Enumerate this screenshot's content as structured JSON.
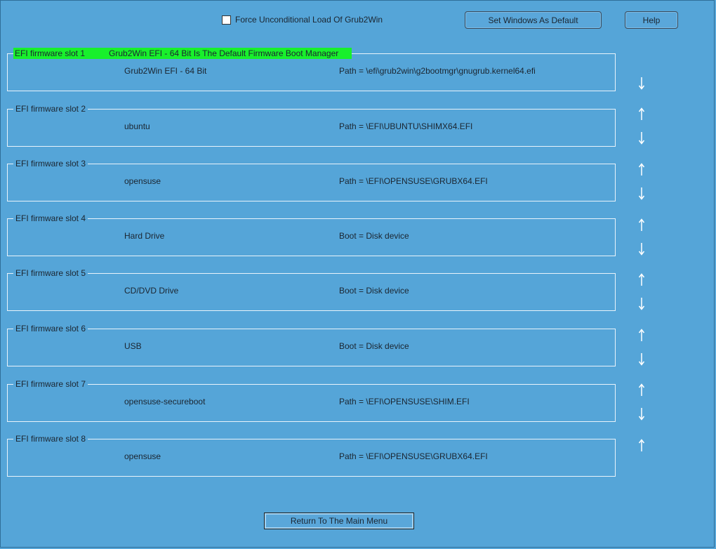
{
  "top": {
    "force_label": "Force Unconditional Load Of Grub2Win",
    "force_checked": false,
    "set_default_label": "Set Windows As Default",
    "help_label": "Help"
  },
  "slots": [
    {
      "legend": "EFI firmware slot 1",
      "note": "Grub2Win EFI - 64 Bit Is The Default Firmware Boot Manager",
      "name": "Grub2Win EFI - 64 Bit",
      "path": "Path = \\efi\\grub2win\\g2bootmgr\\gnugrub.kernel64.efi"
    },
    {
      "legend": "EFI firmware slot 2",
      "name": "ubuntu",
      "path": "Path = \\EFI\\UBUNTU\\SHIMX64.EFI"
    },
    {
      "legend": "EFI firmware slot 3",
      "name": "opensuse",
      "path": "Path = \\EFI\\OPENSUSE\\GRUBX64.EFI"
    },
    {
      "legend": "EFI firmware slot 4",
      "name": "Hard Drive",
      "path": "Boot = Disk device"
    },
    {
      "legend": "EFI firmware slot 5",
      "name": "CD/DVD Drive",
      "path": "Boot = Disk device"
    },
    {
      "legend": "EFI firmware slot 6",
      "name": "USB",
      "path": "Boot = Disk device"
    },
    {
      "legend": "EFI firmware slot 7",
      "name": "opensuse-secureboot",
      "path": "Path = \\EFI\\OPENSUSE\\SHIM.EFI"
    },
    {
      "legend": "EFI firmware slot 8",
      "name": "opensuse",
      "path": "Path = \\EFI\\OPENSUSE\\GRUBX64.EFI"
    }
  ],
  "bottom": {
    "return_label": "Return To The Main Menu"
  },
  "colors": {
    "background": "#55a5d8",
    "default_highlight": "#18f02c",
    "arrow": "#ffffff"
  }
}
